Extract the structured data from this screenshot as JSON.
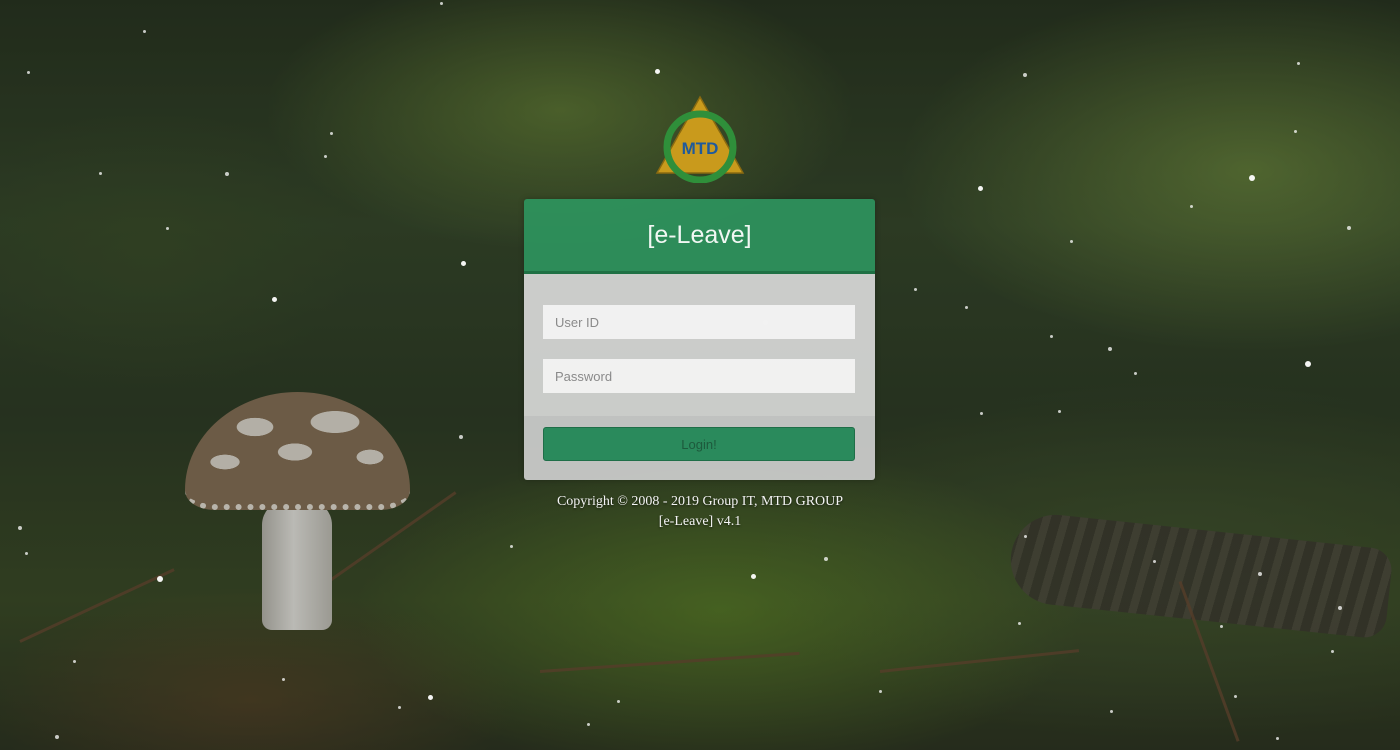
{
  "logo": {
    "text": "MTD",
    "icon": "mtd-triangle-logo"
  },
  "login": {
    "title": "[e-Leave]",
    "user_id_placeholder": "User ID",
    "password_placeholder": "Password",
    "button_label": "Login!"
  },
  "footer": {
    "copyright": "Copyright © 2008 - 2019 Group IT, MTD GROUP",
    "version": "[e-Leave] v4.1"
  },
  "colors": {
    "header_green": "#2e965f",
    "button_green": "#2a8a5c",
    "logo_gold": "#c99a1c",
    "logo_green": "#2f8f3a"
  }
}
